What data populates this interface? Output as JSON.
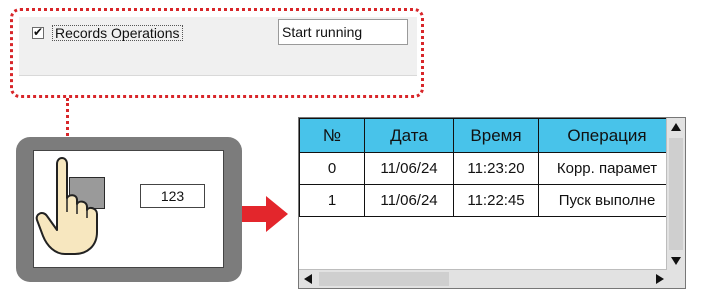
{
  "settings": {
    "checkbox_label": "Records Operations",
    "checkbox_checked": true,
    "text_field_value": "Start running"
  },
  "hmi": {
    "numeric_display": "123"
  },
  "log_table": {
    "columns": [
      "№",
      "Дата",
      "Время",
      "Операция"
    ],
    "rows": [
      [
        "0",
        "11/06/24",
        "11:23:20",
        "Корр. парамет"
      ],
      [
        "1",
        "11/06/24",
        "11:22:45",
        "Пуск выполне"
      ]
    ]
  },
  "colors": {
    "callout_border": "#d8262a",
    "arrow": "#e3262c",
    "table_header": "#48c3ea",
    "device_body": "#7c7c7c"
  },
  "icons": {
    "hand": "pointing-hand-icon",
    "arrow": "right-arrow-icon"
  }
}
